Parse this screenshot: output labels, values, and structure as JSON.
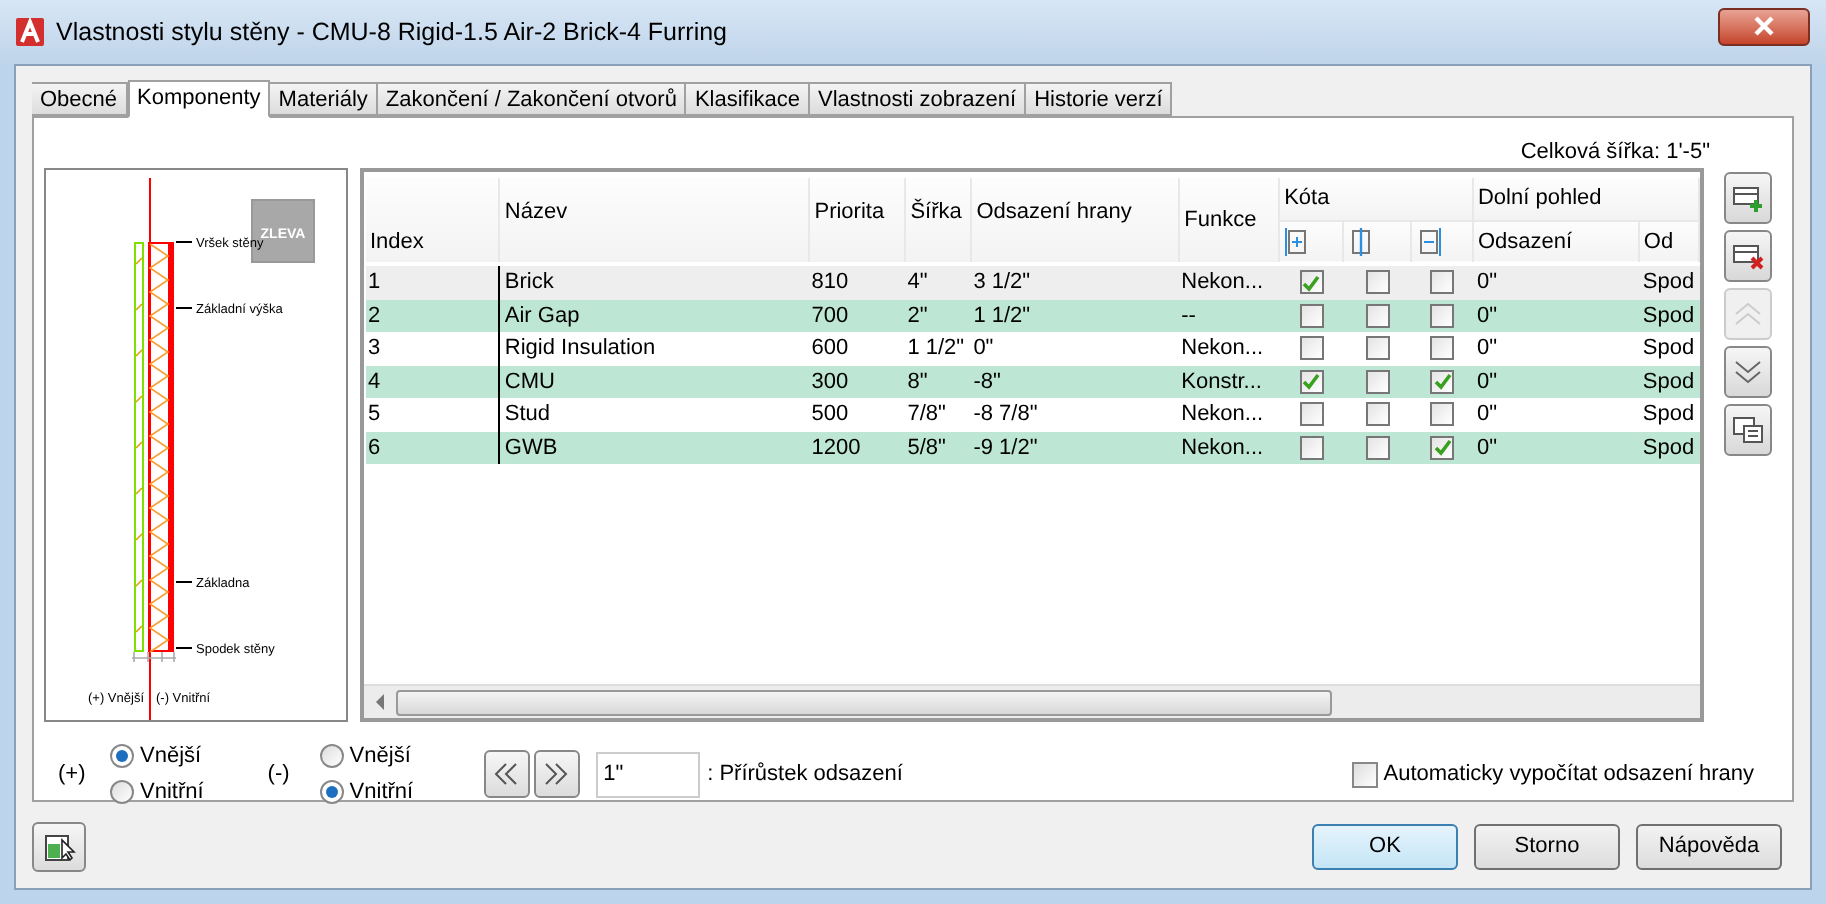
{
  "window": {
    "title": "Vlastnosti stylu stěny - CMU-8 Rigid-1.5 Air-2 Brick-4 Furring"
  },
  "tabs": [
    {
      "label": "Obecné",
      "selected": false
    },
    {
      "label": "Komponenty",
      "selected": true
    },
    {
      "label": "Materiály",
      "selected": false
    },
    {
      "label": "Zakončení / Zakončení otvorů",
      "selected": false
    },
    {
      "label": "Klasifikace",
      "selected": false
    },
    {
      "label": "Vlastnosti zobrazení",
      "selected": false
    },
    {
      "label": "Historie verzí",
      "selected": false
    }
  ],
  "total_width": "Celková šířka: 1'-5\"",
  "preview": {
    "view_badge": "ZLEVA",
    "markers": [
      "Vršek stěny",
      "Základní výška",
      "Základna",
      "Spodek stěny"
    ],
    "side_labels": [
      "(+) Vnější",
      "(-) Vnitřní"
    ]
  },
  "table": {
    "columns": [
      "Index",
      "Název",
      "Priorita",
      "Šířka",
      "Odsazení hrany",
      "Funkce"
    ],
    "groups": [
      {
        "label": "Kóta"
      },
      {
        "label": "Dolní pohled",
        "columns": [
          "Odsazení",
          "Od"
        ]
      }
    ],
    "rows": [
      {
        "index": "1",
        "name": "Brick",
        "priority": "810",
        "width": "4\"",
        "edge_offset": "3 1/2\"",
        "function": "Nekon...",
        "dimension": [
          true,
          false,
          false
        ],
        "bottom_offset": "0\"",
        "from": "Spod",
        "selected": true
      },
      {
        "index": "2",
        "name": "Air Gap",
        "priority": "700",
        "width": "2\"",
        "edge_offset": "1 1/2\"",
        "function": "--",
        "dimension": [
          false,
          false,
          false
        ],
        "bottom_offset": "0\"",
        "from": "Spod",
        "selected": false
      },
      {
        "index": "3",
        "name": "Rigid Insulation",
        "priority": "600",
        "width": "1 1/2\"",
        "edge_offset": "0\"",
        "function": "Nekon...",
        "dimension": [
          false,
          false,
          false
        ],
        "bottom_offset": "0\"",
        "from": "Spod",
        "selected": false
      },
      {
        "index": "4",
        "name": "CMU",
        "priority": "300",
        "width": "8\"",
        "edge_offset": "-8\"",
        "function": "Konstr...",
        "dimension": [
          true,
          false,
          true
        ],
        "bottom_offset": "0\"",
        "from": "Spod",
        "selected": false
      },
      {
        "index": "5",
        "name": "Stud",
        "priority": "500",
        "width": "7/8\"",
        "edge_offset": "-8 7/8\"",
        "function": "Nekon...",
        "dimension": [
          false,
          false,
          false
        ],
        "bottom_offset": "0\"",
        "from": "Spod",
        "selected": false
      },
      {
        "index": "6",
        "name": "GWB",
        "priority": "1200",
        "width": "5/8\"",
        "edge_offset": "-9 1/2\"",
        "function": "Nekon...",
        "dimension": [
          false,
          false,
          true
        ],
        "bottom_offset": "0\"",
        "from": "Spod",
        "selected": false
      }
    ]
  },
  "side_buttons": [
    {
      "kind": "add",
      "disabled": false
    },
    {
      "kind": "delete",
      "disabled": false
    },
    {
      "kind": "up",
      "disabled": true
    },
    {
      "kind": "down",
      "disabled": false
    },
    {
      "kind": "settings",
      "disabled": false
    }
  ],
  "offset_groups": [
    {
      "label": "(+)",
      "options": [
        {
          "label": "Vnější",
          "selected": true
        },
        {
          "label": "Vnitřní",
          "selected": false
        }
      ]
    },
    {
      "label": "(-)",
      "options": [
        {
          "label": "Vnější",
          "selected": false
        },
        {
          "label": "Vnitřní",
          "selected": true
        }
      ]
    }
  ],
  "increment": {
    "value": "1\"",
    "label": ": Přírůstek odsazení"
  },
  "auto_offset": {
    "label": "Automaticky vypočítat odsazení hrany",
    "checked": false
  },
  "buttons": [
    {
      "label": "OK",
      "default": true
    },
    {
      "label": "Storno",
      "default": false
    },
    {
      "label": "Nápověda",
      "default": false
    }
  ]
}
